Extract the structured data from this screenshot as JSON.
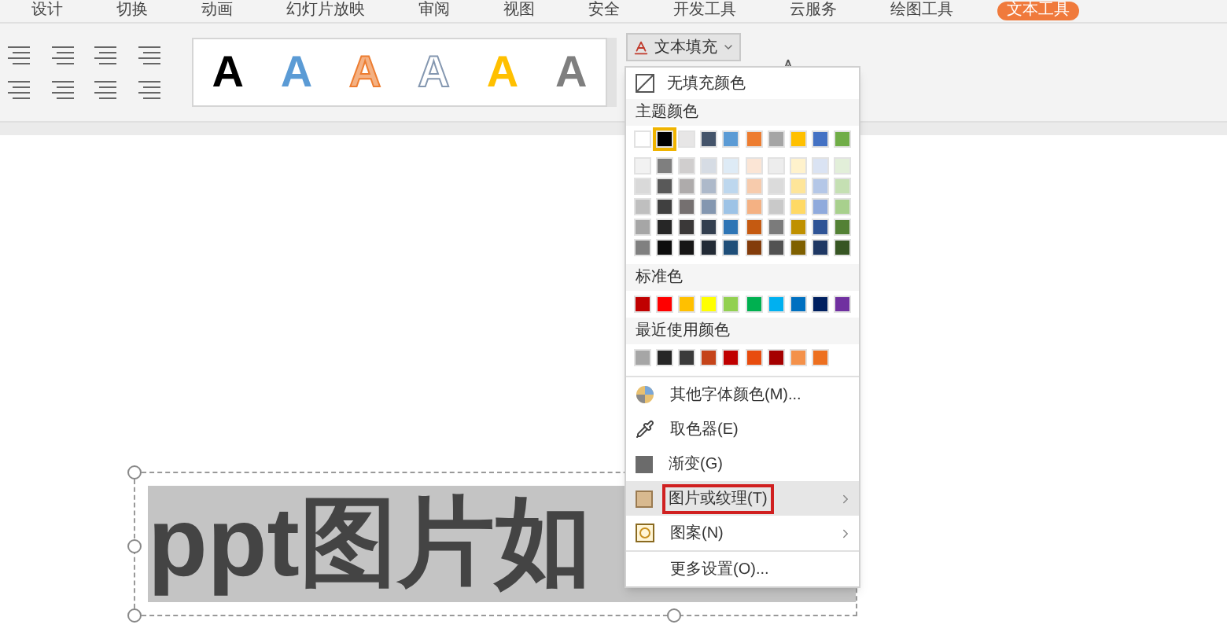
{
  "ribbon_tabs": [
    {
      "label": "设计",
      "selected": false
    },
    {
      "label": "切换",
      "selected": false
    },
    {
      "label": "动画",
      "selected": false
    },
    {
      "label": "幻灯片放映",
      "selected": false
    },
    {
      "label": "审阅",
      "selected": false
    },
    {
      "label": "视图",
      "selected": false
    },
    {
      "label": "安全",
      "selected": false
    },
    {
      "label": "开发工具",
      "selected": false
    },
    {
      "label": "云服务",
      "selected": false
    },
    {
      "label": "绘图工具",
      "selected": false
    },
    {
      "label": "文本工具",
      "selected": true
    }
  ],
  "style_gallery": [
    {
      "label": "A",
      "kind": "solid"
    },
    {
      "label": "A",
      "kind": "blue"
    },
    {
      "label": "A",
      "kind": "orange_outline"
    },
    {
      "label": "A",
      "kind": "outline"
    },
    {
      "label": "A",
      "kind": "yellow"
    },
    {
      "label": "A",
      "kind": "gray"
    }
  ],
  "text_fill_button": {
    "label": "文本填充"
  },
  "menu": {
    "no_fill": "无填充颜色",
    "theme_header": "主题颜色",
    "theme_colors": [
      {
        "color": "#ffffff",
        "selected": false
      },
      {
        "color": "#000000",
        "selected": true
      },
      {
        "color": "#e7e6e6",
        "selected": false
      },
      {
        "color": "#44546a",
        "selected": false
      },
      {
        "color": "#5b9bd5",
        "selected": false
      },
      {
        "color": "#ed7d31",
        "selected": false
      },
      {
        "color": "#a5a5a5",
        "selected": false
      },
      {
        "color": "#ffc000",
        "selected": false
      },
      {
        "color": "#4472c4",
        "selected": false
      },
      {
        "color": "#70ad47",
        "selected": false
      }
    ],
    "theme_shades": [
      [
        {
          "color": "#f2f2f2"
        },
        {
          "color": "#7f7f7f"
        },
        {
          "color": "#d0cece"
        },
        {
          "color": "#d6dce4"
        },
        {
          "color": "#deebf6"
        },
        {
          "color": "#fbe5d5"
        },
        {
          "color": "#ededed"
        },
        {
          "color": "#fff2cc"
        },
        {
          "color": "#dae3f3"
        },
        {
          "color": "#e2efd9"
        }
      ],
      [
        {
          "color": "#d9d9d9"
        },
        {
          "color": "#595959"
        },
        {
          "color": "#aeabab"
        },
        {
          "color": "#adb9ca"
        },
        {
          "color": "#bdd7ee"
        },
        {
          "color": "#f7cbac"
        },
        {
          "color": "#dbdbdb"
        },
        {
          "color": "#fee599"
        },
        {
          "color": "#b4c7e7"
        },
        {
          "color": "#c5e0b3"
        }
      ],
      [
        {
          "color": "#bfbfbf"
        },
        {
          "color": "#404040"
        },
        {
          "color": "#757070"
        },
        {
          "color": "#8497b0"
        },
        {
          "color": "#9dc3e6"
        },
        {
          "color": "#f4b183"
        },
        {
          "color": "#c9c9c9"
        },
        {
          "color": "#ffd965"
        },
        {
          "color": "#8faadc"
        },
        {
          "color": "#a8d08d"
        }
      ],
      [
        {
          "color": "#a6a6a6"
        },
        {
          "color": "#262626"
        },
        {
          "color": "#3a3838"
        },
        {
          "color": "#333f4f"
        },
        {
          "color": "#2e75b5"
        },
        {
          "color": "#c55a11"
        },
        {
          "color": "#7b7b7b"
        },
        {
          "color": "#bf9000"
        },
        {
          "color": "#2f5496"
        },
        {
          "color": "#538135"
        }
      ],
      [
        {
          "color": "#808080"
        },
        {
          "color": "#0d0d0d"
        },
        {
          "color": "#171616"
        },
        {
          "color": "#222a35"
        },
        {
          "color": "#1f4e79"
        },
        {
          "color": "#833c0b"
        },
        {
          "color": "#525252"
        },
        {
          "color": "#7f6000"
        },
        {
          "color": "#1f3864"
        },
        {
          "color": "#375623"
        }
      ]
    ],
    "standard_header": "标准色",
    "standard_colors": [
      {
        "color": "#c00000"
      },
      {
        "color": "#ff0000"
      },
      {
        "color": "#ffc000"
      },
      {
        "color": "#ffff00"
      },
      {
        "color": "#92d050"
      },
      {
        "color": "#00b050"
      },
      {
        "color": "#00b0f0"
      },
      {
        "color": "#0070c0"
      },
      {
        "color": "#002060"
      },
      {
        "color": "#7030a0"
      }
    ],
    "recent_header": "最近使用颜色",
    "recent_colors": [
      {
        "color": "#a6a6a6"
      },
      {
        "color": "#262626"
      },
      {
        "color": "#3b3b3b"
      },
      {
        "color": "#c5441a"
      },
      {
        "color": "#c00000"
      },
      {
        "color": "#e84c0e"
      },
      {
        "color": "#a50000"
      },
      {
        "color": "#f4914a"
      },
      {
        "color": "#ed7020"
      }
    ],
    "items": [
      {
        "label": "其他字体颜色(M)...",
        "kind": "wheel",
        "selected": false,
        "submenu": false
      },
      {
        "label": "取色器(E)",
        "kind": "picker",
        "selected": false,
        "submenu": false
      },
      {
        "label": "渐变(G)",
        "kind": "gradient",
        "selected": false,
        "submenu": false
      },
      {
        "label": "图片或纹理(T)",
        "kind": "texture",
        "selected": true,
        "submenu": true
      },
      {
        "label": "图案(N)",
        "kind": "pattern",
        "selected": false,
        "submenu": true
      },
      {
        "label": "更多设置(O)...",
        "kind": "plain",
        "selected": false,
        "submenu": false
      }
    ]
  },
  "slide": {
    "text": "ppt图片如"
  }
}
